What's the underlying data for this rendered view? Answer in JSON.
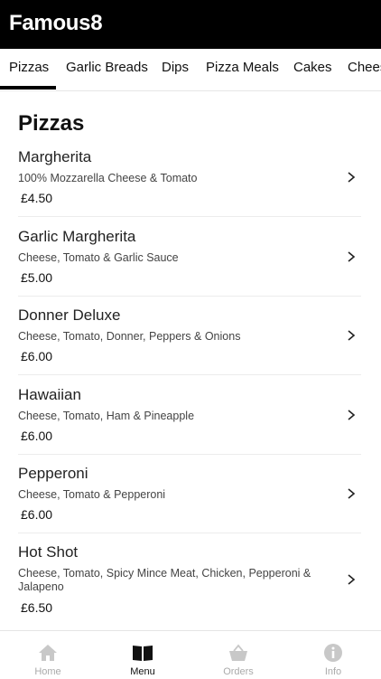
{
  "app": {
    "title": "Famous8"
  },
  "tabs": [
    {
      "label": "Pizzas",
      "active": true
    },
    {
      "label": "Garlic Breads"
    },
    {
      "label": "Dips"
    },
    {
      "label": "Pizza Meals"
    },
    {
      "label": "Cakes"
    },
    {
      "label": "Chees"
    }
  ],
  "section": {
    "title": "Pizzas"
  },
  "items": [
    {
      "name": "Margherita",
      "description": "100% Mozzarella Cheese & Tomato",
      "price": "£4.50"
    },
    {
      "name": "Garlic Margherita",
      "description": "Cheese, Tomato & Garlic Sauce",
      "price": "£5.00"
    },
    {
      "name": "Donner Deluxe",
      "description": "Cheese, Tomato, Donner, Peppers & Onions",
      "price": "£6.00"
    },
    {
      "name": "Hawaiian",
      "description": "Cheese, Tomato, Ham & Pineapple",
      "price": "£6.00"
    },
    {
      "name": "Pepperoni",
      "description": "Cheese, Tomato & Pepperoni",
      "price": "£6.00"
    },
    {
      "name": "Hot Shot",
      "description": "Cheese, Tomato, Spicy Mince Meat, Chicken, Pepperoni & Jalapeno",
      "price": "£6.50"
    }
  ],
  "bottom_nav": [
    {
      "label": "Home",
      "icon": "home-icon"
    },
    {
      "label": "Menu",
      "icon": "book-icon",
      "active": true
    },
    {
      "label": "Orders",
      "icon": "basket-icon"
    },
    {
      "label": "Info",
      "icon": "info-icon"
    }
  ],
  "colors": {
    "header_bg": "#000000",
    "active": "#111111",
    "inactive": "#aaaaaa"
  }
}
